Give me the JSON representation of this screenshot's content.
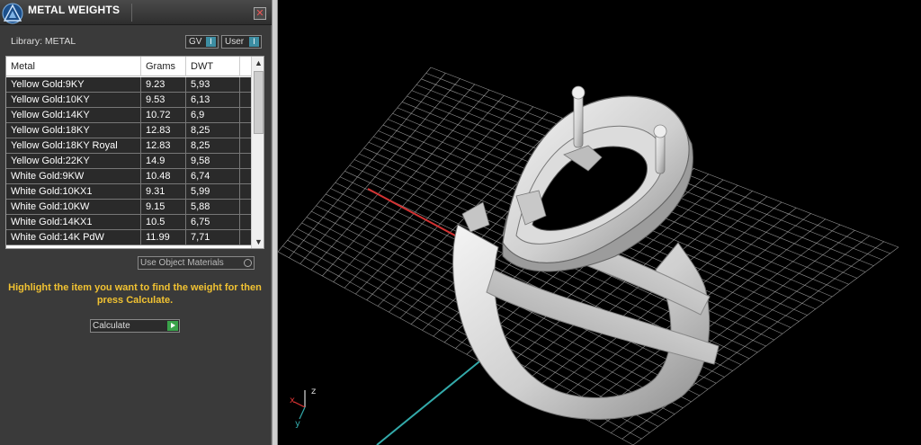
{
  "window": {
    "title": "METAL WEIGHTS",
    "close_label": "✕"
  },
  "library": {
    "label": "Library: METAL",
    "gv_label": "GV",
    "user_label": "User",
    "indicator": "I"
  },
  "table": {
    "columns": [
      "Metal",
      "Grams",
      "DWT"
    ],
    "rows": [
      [
        "Yellow Gold:9KY",
        "9.23",
        "5,93"
      ],
      [
        "Yellow Gold:10KY",
        "9.53",
        "6,13"
      ],
      [
        "Yellow Gold:14KY",
        "10.72",
        "6,9"
      ],
      [
        "Yellow Gold:18KY",
        "12.83",
        "8,25"
      ],
      [
        "Yellow Gold:18KY Royal",
        "12.83",
        "8,25"
      ],
      [
        "Yellow Gold:22KY",
        "14.9",
        "9,58"
      ],
      [
        "White Gold:9KW",
        "10.48",
        "6,74"
      ],
      [
        "White Gold:10KX1",
        "9.31",
        "5,99"
      ],
      [
        "White Gold:10KW",
        "9.15",
        "5,88"
      ],
      [
        "White Gold:14KX1",
        "10.5",
        "6,75"
      ],
      [
        "White Gold:14K PdW",
        "11.99",
        "7,71"
      ]
    ]
  },
  "use_object_materials": "Use Object Materials",
  "instruction": "Highlight the item you want to find the weight for then press Calculate.",
  "calculate_label": "Calculate",
  "axes": {
    "x": "x",
    "y": "y",
    "z": "z"
  },
  "colors": {
    "panel_bg": "#3a3a3a",
    "row_bg": "#2a2a2a",
    "instruction": "#f1c232",
    "indicator": "#3d8ea3",
    "go_button": "#3aa34a",
    "grid": "#bfbfbf",
    "axis_x": "#d33333",
    "axis_y": "#33aaaa"
  },
  "icons": [
    "app-logo-icon",
    "close-icon",
    "scroll-up-icon",
    "scroll-down-icon",
    "radio-icon",
    "play-icon"
  ]
}
